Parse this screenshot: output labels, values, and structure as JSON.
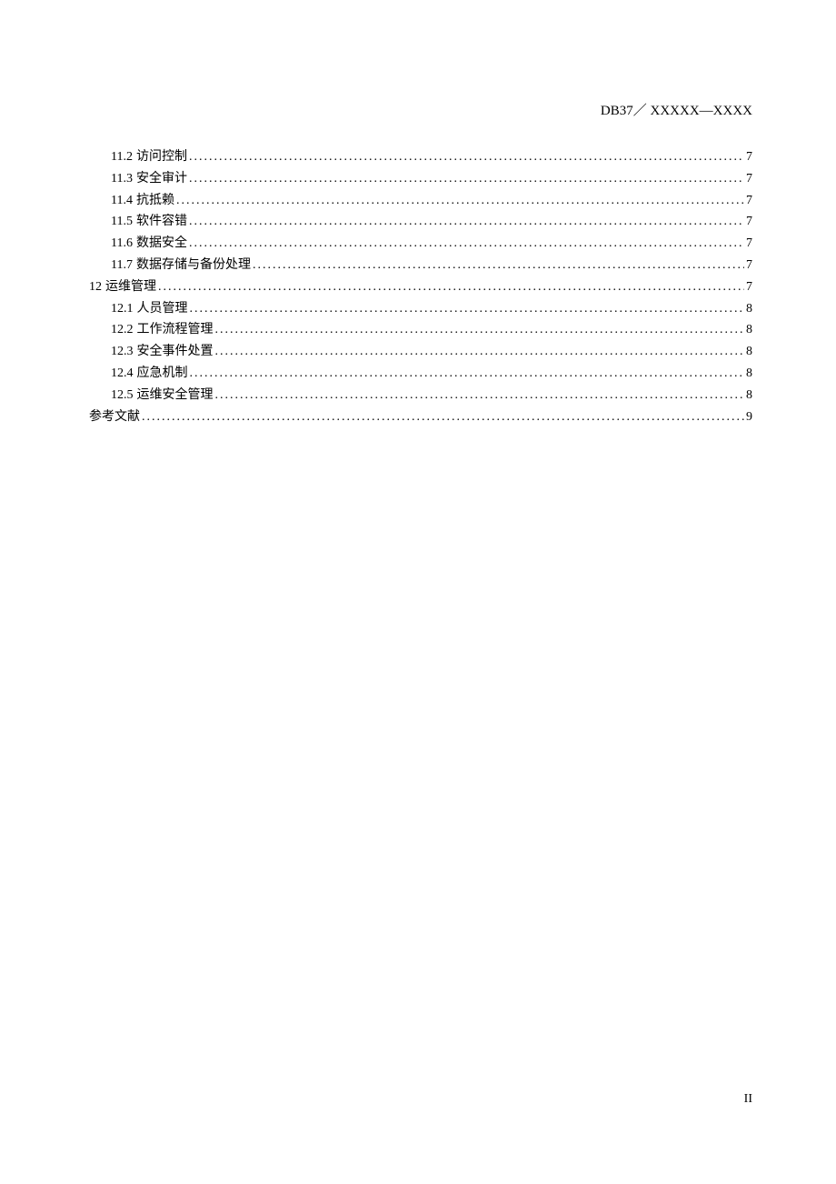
{
  "header": "DB37／ XXXXX—XXXX",
  "toc": [
    {
      "level": 2,
      "num": "11.2",
      "title": "访问控制",
      "page": "7"
    },
    {
      "level": 2,
      "num": "11.3",
      "title": "安全审计",
      "page": "7"
    },
    {
      "level": 2,
      "num": "11.4",
      "title": "抗抵赖",
      "page": "7"
    },
    {
      "level": 2,
      "num": "11.5",
      "title": "软件容错",
      "page": "7"
    },
    {
      "level": 2,
      "num": "11.6",
      "title": "数据安全",
      "page": "7"
    },
    {
      "level": 2,
      "num": "11.7",
      "title": "数据存储与备份处理",
      "page": "7"
    },
    {
      "level": 1,
      "num": "12",
      "title": "运维管理",
      "page": "7"
    },
    {
      "level": 2,
      "num": "12.1",
      "title": "人员管理",
      "page": "8"
    },
    {
      "level": 2,
      "num": "12.2",
      "title": "工作流程管理",
      "page": "8"
    },
    {
      "level": 2,
      "num": "12.3",
      "title": "安全事件处置",
      "page": "8"
    },
    {
      "level": 2,
      "num": "12.4",
      "title": "应急机制",
      "page": "8"
    },
    {
      "level": 2,
      "num": "12.5",
      "title": "运维安全管理",
      "page": "8"
    },
    {
      "level": 1,
      "num": "",
      "title": "参考文献",
      "page": "9"
    }
  ],
  "pageNumber": "II"
}
